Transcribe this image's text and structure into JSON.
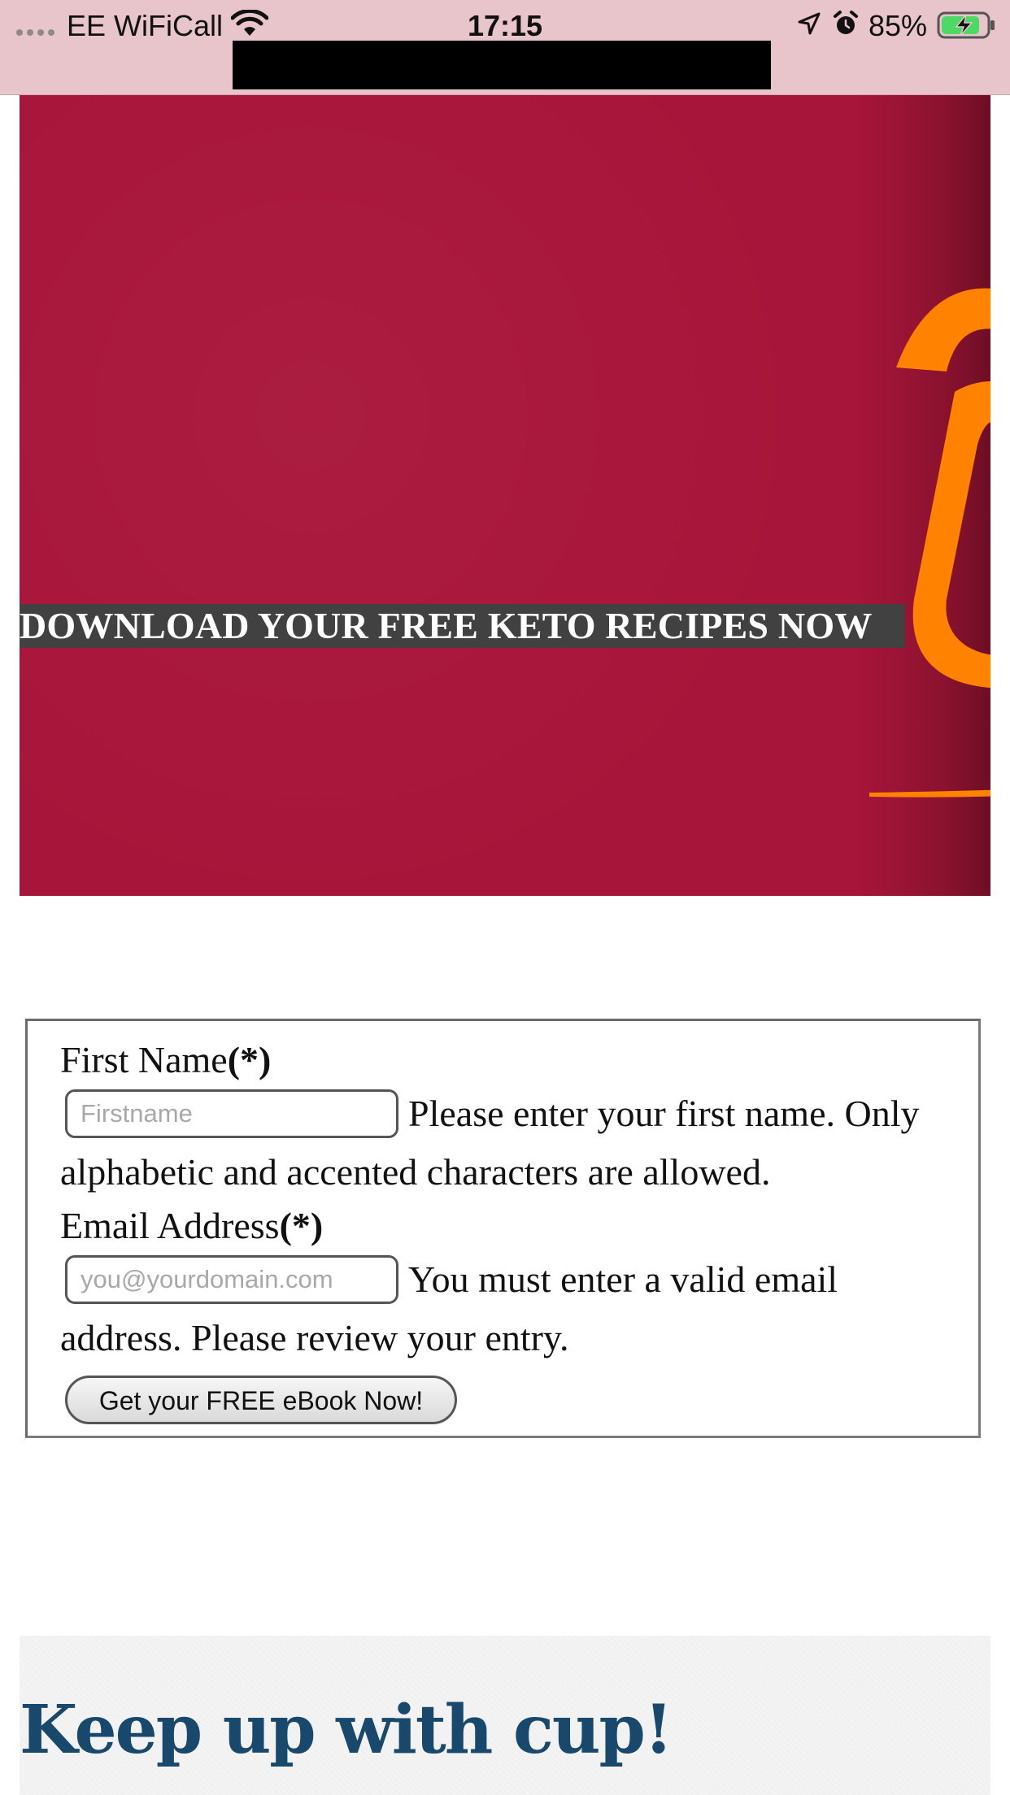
{
  "status_bar": {
    "carrier": "EE WiFiCall",
    "time": "17:15",
    "battery": "85%",
    "icons": [
      "signal-dots-icon",
      "wifi-icon",
      "location-arrow-icon",
      "alarm-clock-icon",
      "battery-charging-icon"
    ],
    "battery_level": 0.85,
    "battery_color": "#4cd964"
  },
  "hero": {
    "headline": "DOWNLOAD YOUR FREE KETO RECIPES NOW",
    "background_color": "#a8153a",
    "accent_color": "#ff8200"
  },
  "form": {
    "first_name_label": "First Name",
    "first_name_required": "(*)",
    "first_name_placeholder": "Firstname",
    "first_name_hint": "Please enter your first name. Only alphabetic and accented characters are allowed.",
    "email_label": "Email Address",
    "email_required": "(*)",
    "email_placeholder": "you@yourdomain.com",
    "email_hint": "You must enter a valid email address. Please review your entry.",
    "submit_label": "Get your FREE eBook Now!"
  },
  "newsletter": {
    "heading": "Keep up with cup!",
    "heading_color": "#18486b"
  }
}
